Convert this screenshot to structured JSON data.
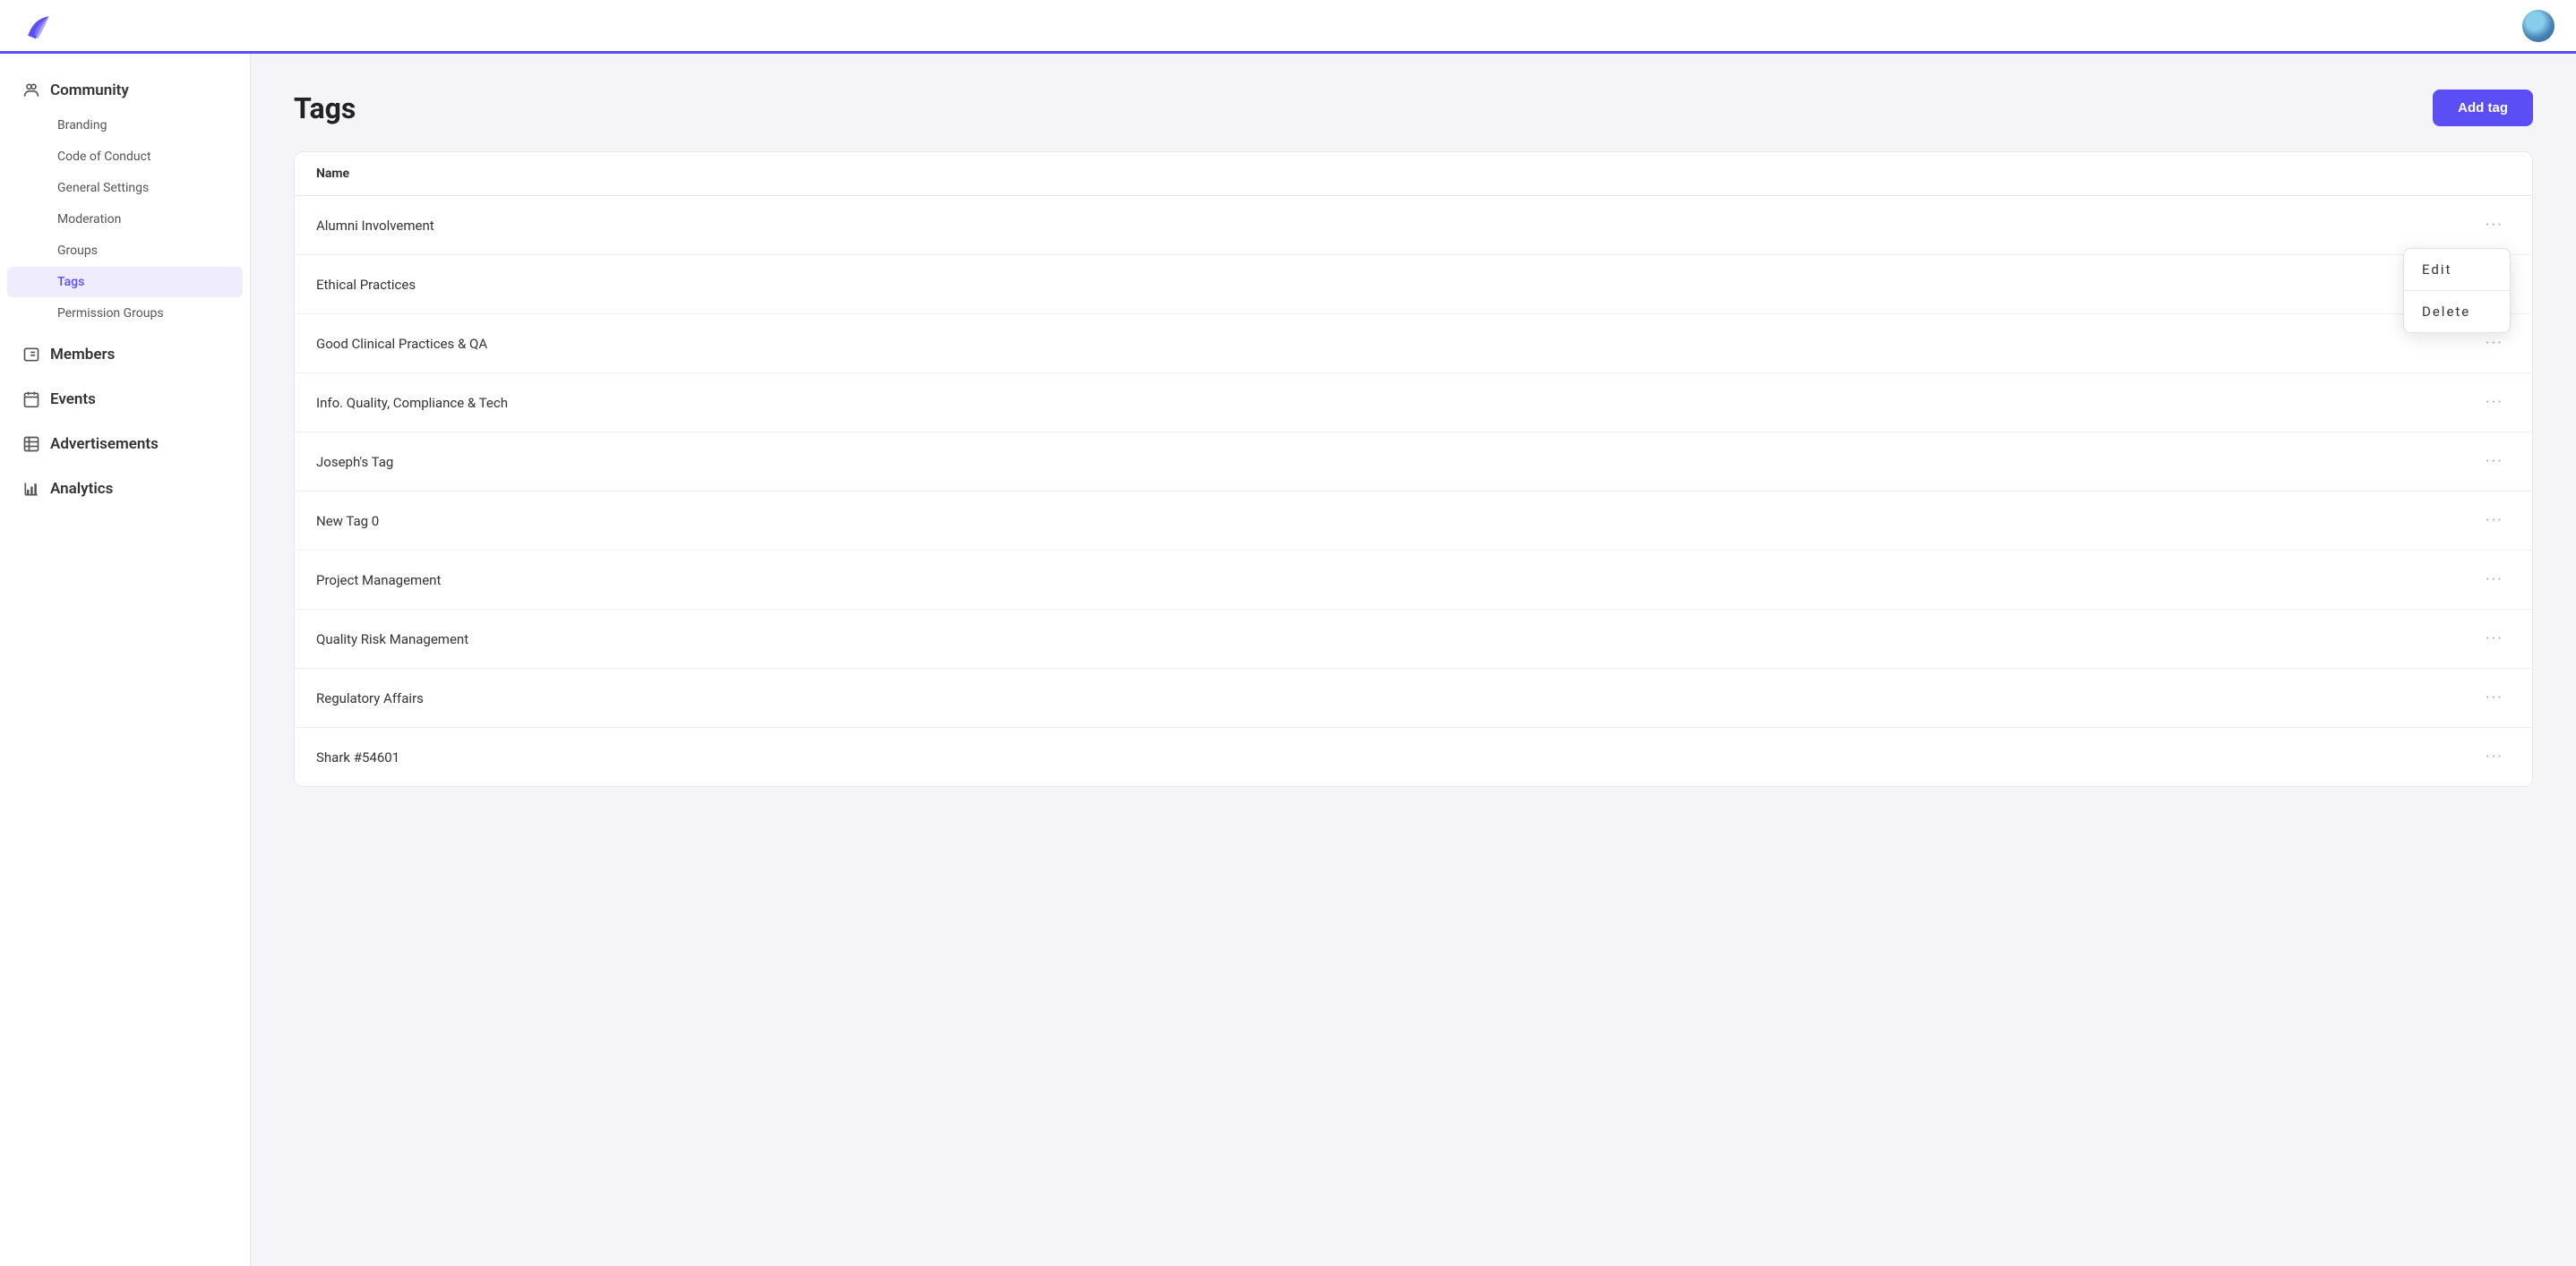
{
  "header": {
    "logo_alt": "App Logo"
  },
  "sidebar": {
    "sections": [
      {
        "id": "community",
        "label": "Community",
        "icon": "community-icon",
        "sub_items": [
          {
            "id": "branding",
            "label": "Branding",
            "active": false
          },
          {
            "id": "code-of-conduct",
            "label": "Code of Conduct",
            "active": false
          },
          {
            "id": "general-settings",
            "label": "General Settings",
            "active": false
          },
          {
            "id": "moderation",
            "label": "Moderation",
            "active": false
          },
          {
            "id": "groups",
            "label": "Groups",
            "active": false
          },
          {
            "id": "tags",
            "label": "Tags",
            "active": true
          },
          {
            "id": "permission-groups",
            "label": "Permission Groups",
            "active": false
          }
        ]
      },
      {
        "id": "members",
        "label": "Members",
        "icon": "members-icon",
        "sub_items": []
      },
      {
        "id": "events",
        "label": "Events",
        "icon": "events-icon",
        "sub_items": []
      },
      {
        "id": "advertisements",
        "label": "Advertisements",
        "icon": "advertisements-icon",
        "sub_items": []
      },
      {
        "id": "analytics",
        "label": "Analytics",
        "icon": "analytics-icon",
        "sub_items": []
      }
    ]
  },
  "main": {
    "page_title": "Tags",
    "add_button_label": "Add tag",
    "table": {
      "column_header": "Name",
      "rows": [
        {
          "id": 1,
          "name": "Alumni Involvement",
          "menu_open": true
        },
        {
          "id": 2,
          "name": "Ethical Practices",
          "menu_open": false
        },
        {
          "id": 3,
          "name": "Good Clinical Practices & QA",
          "menu_open": false
        },
        {
          "id": 4,
          "name": "Info. Quality, Compliance & Tech",
          "menu_open": false
        },
        {
          "id": 5,
          "name": "Joseph's Tag",
          "menu_open": false
        },
        {
          "id": 6,
          "name": "New Tag 0",
          "menu_open": false
        },
        {
          "id": 7,
          "name": "Project Management",
          "menu_open": false
        },
        {
          "id": 8,
          "name": "Quality Risk Management",
          "menu_open": false
        },
        {
          "id": 9,
          "name": "Regulatory Affairs",
          "menu_open": false
        },
        {
          "id": 10,
          "name": "Shark #54601",
          "menu_open": false
        }
      ],
      "context_menu": {
        "edit_label": "Edit",
        "delete_label": "Delete"
      }
    }
  }
}
